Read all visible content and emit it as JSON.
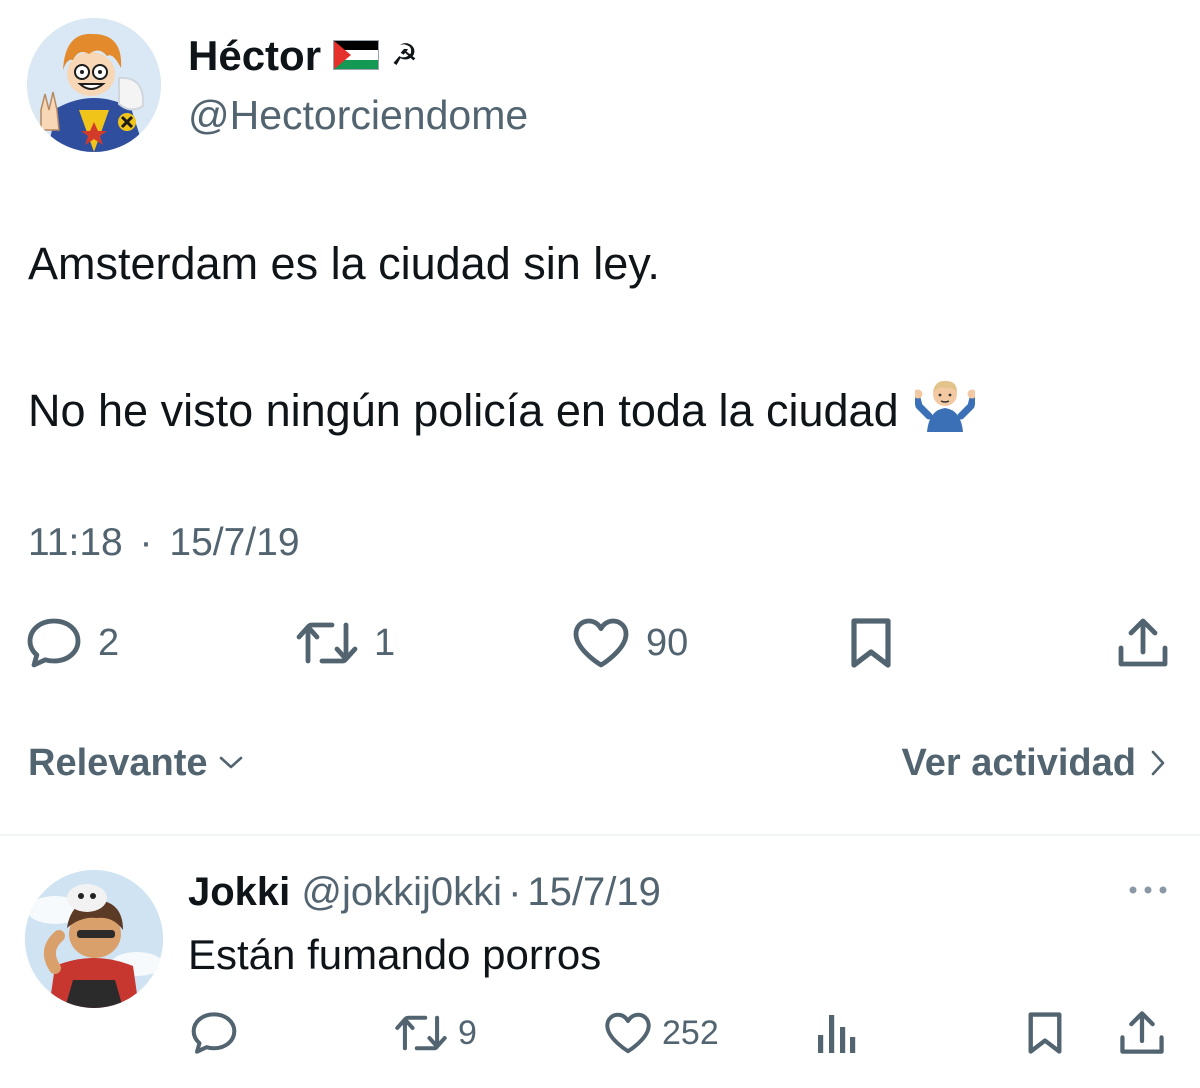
{
  "tweet": {
    "author": {
      "name": "Héctor",
      "flag_icon": "palestine-flag-icon",
      "symbol": "☭",
      "handle": "@Hectorciendome"
    },
    "text_line1": "Amsterdam es la ciudad sin ley.",
    "text_line2": "No he visto ningún policía en toda la ciudad",
    "emoji_icon": "person-shrugging-icon",
    "time": "11:18",
    "date_separator": "·",
    "date": "15/7/19",
    "stats": {
      "replies": "2",
      "retweets": "1",
      "likes": "90"
    }
  },
  "sort_bar": {
    "sort_label": "Relevante",
    "activity_label": "Ver actividad"
  },
  "reply": {
    "name": "Jokki",
    "handle": "@jokkij0kki",
    "separator": "·",
    "date": "15/7/19",
    "text": "Están fumando porros",
    "stats": {
      "retweets": "9",
      "likes": "252"
    }
  },
  "colors": {
    "text_primary": "#0f1419",
    "text_secondary": "#536471",
    "divider": "#eff3f4"
  }
}
